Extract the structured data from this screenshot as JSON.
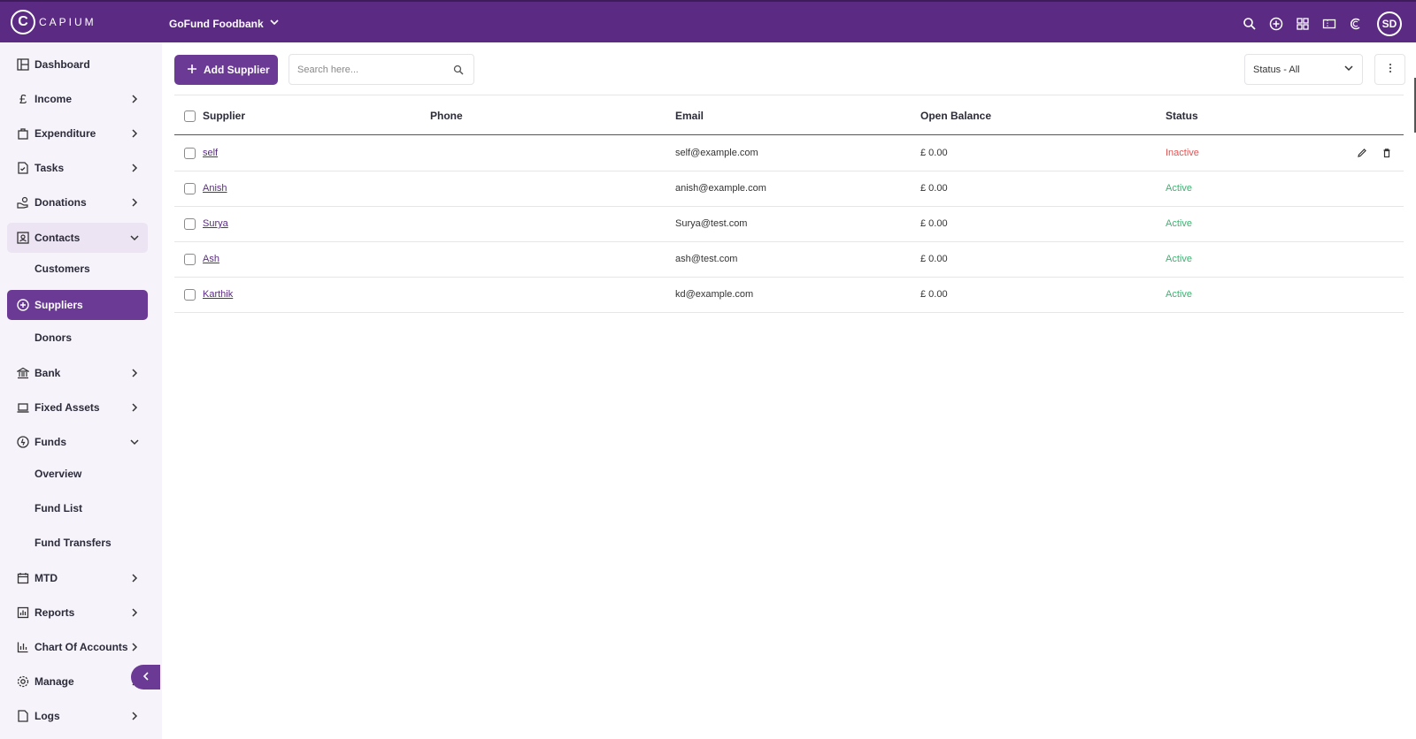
{
  "topbar": {
    "logo_text": "CAPIUM",
    "logo_letter": "C",
    "organization": "GoFund Foodbank",
    "avatar_initials": "SD",
    "icons": [
      "search-icon",
      "plus-circle-icon",
      "apps-grid-icon",
      "ticket-icon",
      "capium-c-icon"
    ]
  },
  "sidebar": {
    "items": [
      {
        "label": "Dashboard",
        "icon": "dashboard-icon"
      },
      {
        "label": "Income",
        "icon": "pound-icon"
      },
      {
        "label": "Expenditure",
        "icon": "bag-icon"
      },
      {
        "label": "Tasks",
        "icon": "tasks-icon"
      },
      {
        "label": "Donations",
        "icon": "donations-icon"
      },
      {
        "label": "Contacts",
        "icon": "contacts-icon"
      },
      {
        "label": "Customers"
      },
      {
        "label": "Suppliers",
        "icon": "add-circle-icon"
      },
      {
        "label": "Donors"
      },
      {
        "label": "Bank",
        "icon": "bank-icon"
      },
      {
        "label": "Fixed Assets",
        "icon": "laptop-icon"
      },
      {
        "label": "Funds",
        "icon": "funds-icon"
      },
      {
        "label": "Overview"
      },
      {
        "label": "Fund List"
      },
      {
        "label": "Fund Transfers"
      },
      {
        "label": "MTD",
        "icon": "calendar-icon"
      },
      {
        "label": "Reports",
        "icon": "reports-icon"
      },
      {
        "label": "Chart Of Accounts",
        "icon": "chart-icon"
      },
      {
        "label": "Manage",
        "icon": "gear-icon"
      },
      {
        "label": "Logs",
        "icon": "logs-icon"
      }
    ]
  },
  "toolbar": {
    "add_label": "Add Supplier",
    "search_placeholder": "Search here...",
    "status_filter": "Status - All"
  },
  "table": {
    "columns": [
      "Supplier",
      "Phone",
      "Email",
      "Open Balance",
      "Status"
    ],
    "rows": [
      {
        "supplier": "self",
        "phone": "",
        "email": "self@example.com",
        "balance": "£ 0.00",
        "status": "Inactive"
      },
      {
        "supplier": "Anish",
        "phone": "",
        "email": "anish@example.com",
        "balance": "£ 0.00",
        "status": "Active"
      },
      {
        "supplier": "Surya",
        "phone": "",
        "email": "Surya@test.com",
        "balance": "£ 0.00",
        "status": "Active"
      },
      {
        "supplier": "Ash",
        "phone": "",
        "email": "ash@test.com",
        "balance": "£ 0.00",
        "status": "Active"
      },
      {
        "supplier": "Karthik",
        "phone": "",
        "email": "kd@example.com",
        "balance": "£ 0.00",
        "status": "Active"
      }
    ]
  },
  "colors": {
    "brand": "#5b2b83",
    "accent": "#6a3a95",
    "active": "#3cb371",
    "inactive": "#e05555"
  }
}
